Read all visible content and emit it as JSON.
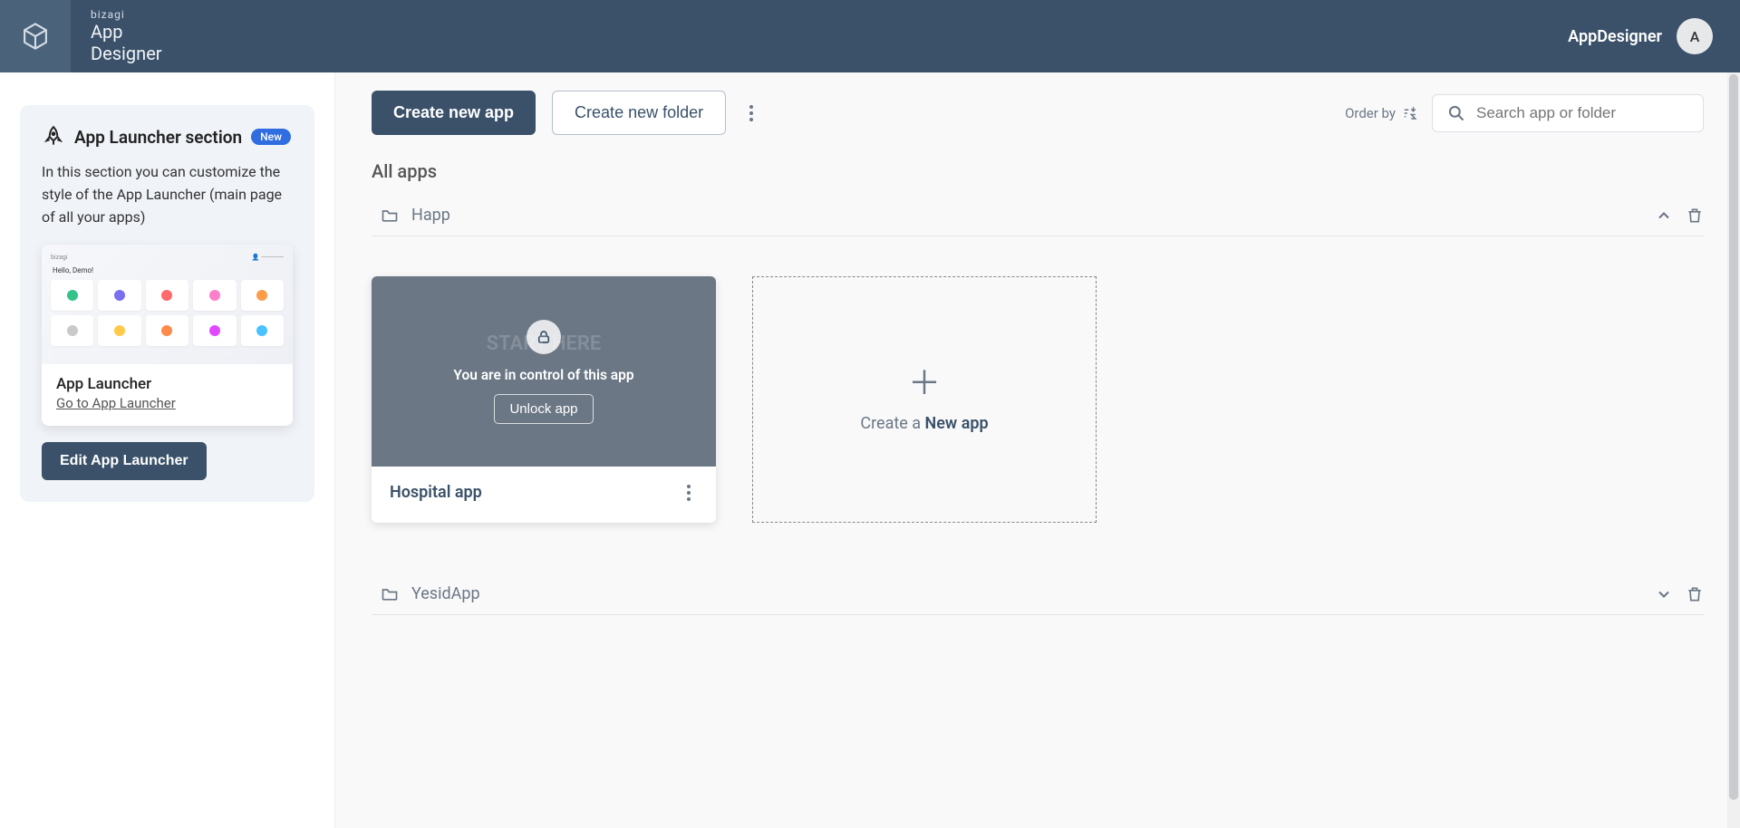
{
  "header": {
    "brand_mark": "bizagi",
    "brand_line1": "App",
    "brand_line2": "Designer",
    "user_label": "AppDesigner",
    "avatar_initial": "A"
  },
  "sidebar": {
    "section_title": "App Launcher section",
    "badge": "New",
    "description": "In this section you can customize the style of the App Launcher (main page of all your apps)",
    "preview_title": "App Launcher",
    "preview_link": "Go to App Launcher",
    "preview_mark": "bizagi",
    "preview_hello": "Hello, Demo!",
    "edit_button": "Edit App Launcher"
  },
  "toolbar": {
    "create_app": "Create new app",
    "create_folder": "Create new folder",
    "order_by_label": "Order by",
    "search_placeholder": "Search app or folder"
  },
  "main": {
    "section_title": "All apps",
    "folders": [
      {
        "name": "Happ",
        "expanded": true
      },
      {
        "name": "YesidApp",
        "expanded": false
      }
    ],
    "locked_app": {
      "control_text": "You are in control of this app",
      "unlock_label": "Unlock app",
      "app_name": "Hospital app",
      "ghost": "START HERE"
    },
    "new_tile": {
      "prefix": "Create a ",
      "bold": "New app"
    }
  },
  "colors": {
    "header_bg": "#3a5169"
  }
}
